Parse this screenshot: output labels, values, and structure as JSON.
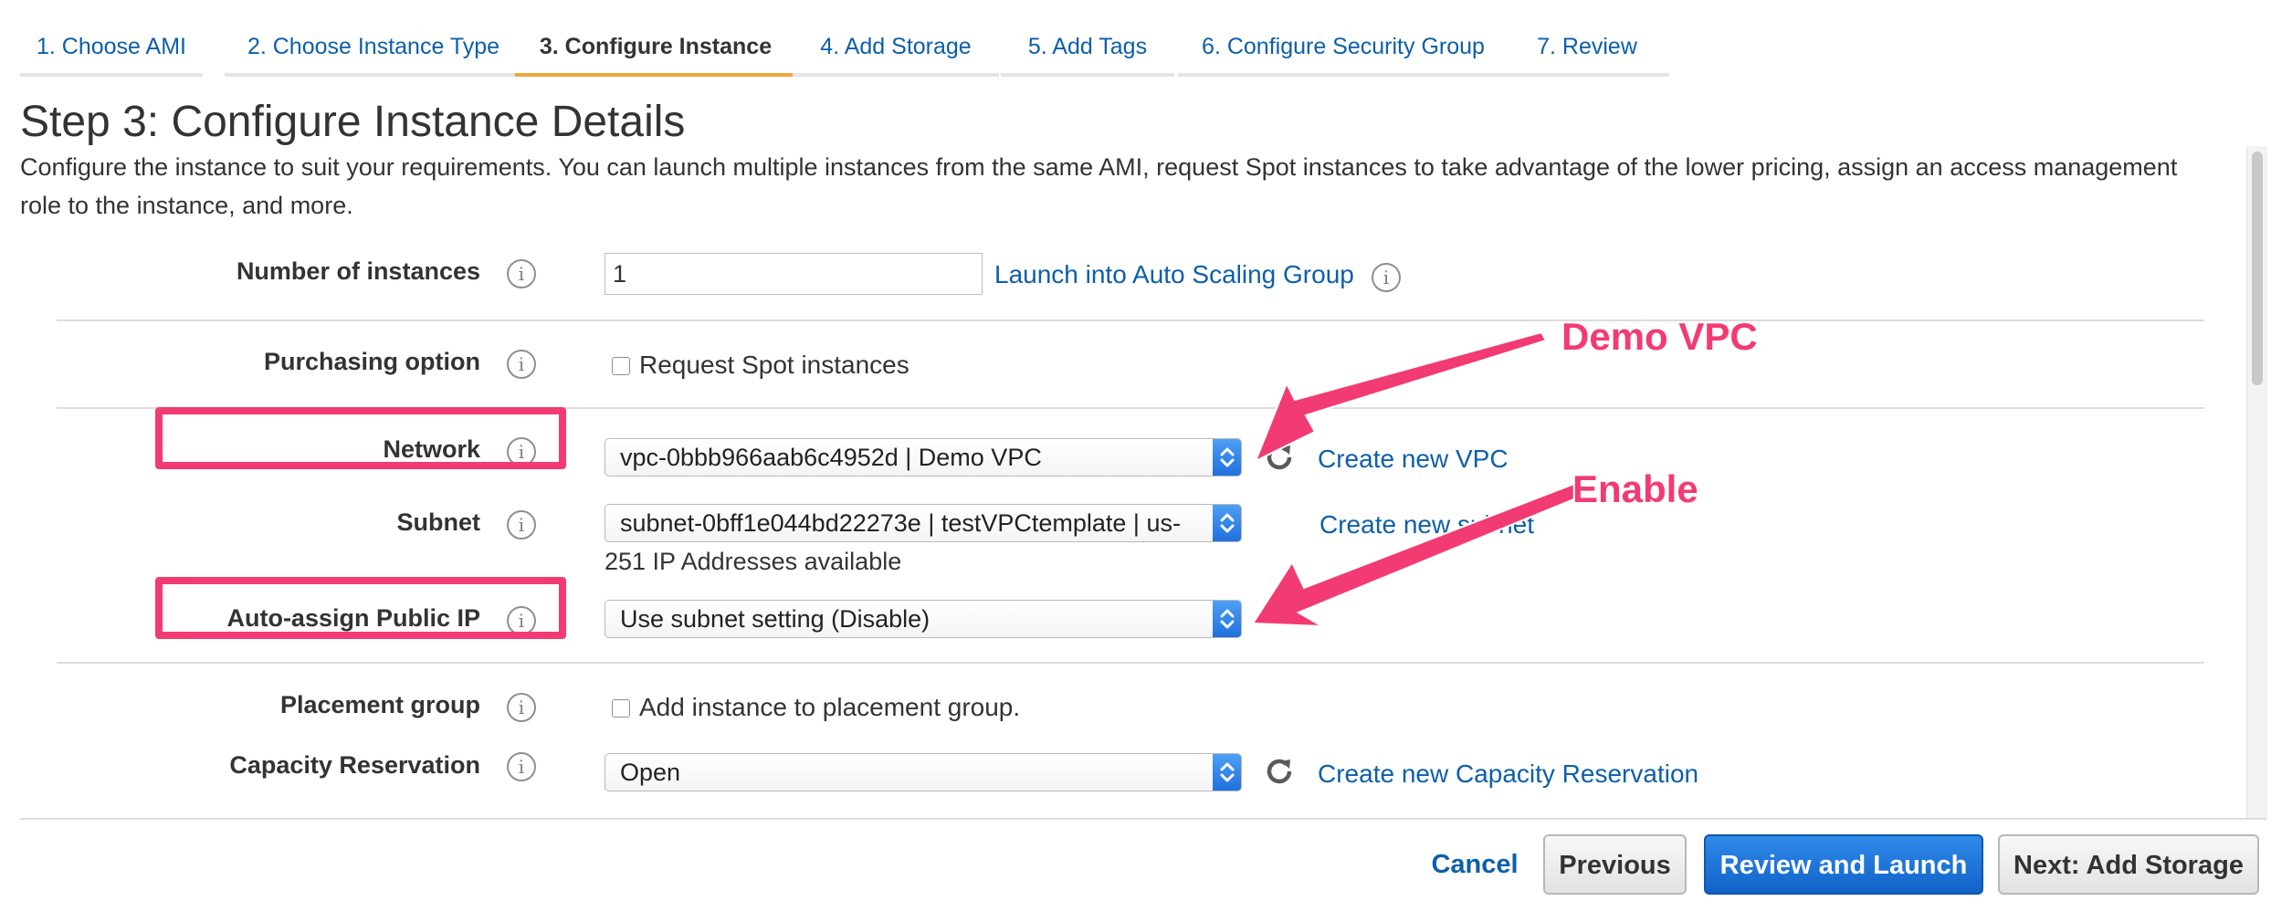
{
  "tabs": [
    {
      "label": "1. Choose AMI"
    },
    {
      "label": "2. Choose Instance Type"
    },
    {
      "label": "3. Configure Instance",
      "active": true
    },
    {
      "label": "4. Add Storage"
    },
    {
      "label": "5. Add Tags"
    },
    {
      "label": "6. Configure Security Group"
    },
    {
      "label": "7. Review"
    }
  ],
  "page": {
    "title": "Step 3: Configure Instance Details",
    "description": "Configure the instance to suit your requirements. You can launch multiple instances from the same AMI, request Spot instances to take advantage of the lower pricing, assign an access management role to the instance, and more."
  },
  "form": {
    "number_of_instances": {
      "label": "Number of instances",
      "value": "1",
      "link": "Launch into Auto Scaling Group"
    },
    "purchasing_option": {
      "label": "Purchasing option",
      "checkbox_label": "Request Spot instances"
    },
    "network": {
      "label": "Network",
      "value": "vpc-0bbb966aab6c4952d | Demo VPC",
      "link": "Create new VPC"
    },
    "subnet": {
      "label": "Subnet",
      "value": "subnet-0bff1e044bd22273e | testVPCtemplate | us-",
      "link": "Create new subnet",
      "helper": "251 IP Addresses available"
    },
    "auto_assign_public_ip": {
      "label": "Auto-assign Public IP",
      "value": "Use subnet setting (Disable)"
    },
    "placement_group": {
      "label": "Placement group",
      "checkbox_label": "Add instance to placement group."
    },
    "capacity_reservation": {
      "label": "Capacity Reservation",
      "value": "Open",
      "link": "Create new Capacity Reservation"
    }
  },
  "annotations": {
    "demo_vpc": "Demo VPC",
    "enable": "Enable",
    "color": "#f23b72"
  },
  "footer": {
    "cancel": "Cancel",
    "previous": "Previous",
    "review_and_launch": "Review and Launch",
    "next": "Next: Add Storage"
  },
  "colors": {
    "link": "#0d5fa8",
    "active_tab": "#f0a63a",
    "primary_button": "#1f6fdc"
  }
}
